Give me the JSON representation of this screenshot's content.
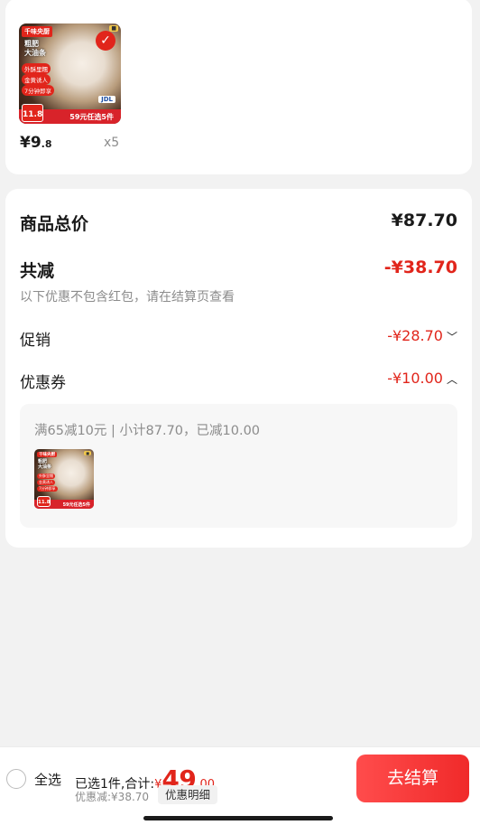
{
  "product": {
    "thumb": {
      "brand": "千味央厨",
      "title_line1": "粗肥",
      "title_line2": "大油条",
      "chips": [
        "外酥里糯",
        "金黄诱人",
        "7分钟即享"
      ],
      "price": "11.8",
      "promo": "59元任选5件",
      "logistics": "JDL"
    },
    "unit_price_main": "¥9",
    "unit_price_decimal": ".8",
    "quantity": "x5",
    "selected": true
  },
  "summary": {
    "goods_total_label": "商品总价",
    "goods_total_value": "¥87.70",
    "total_reduction_label": "共减",
    "total_reduction_value": "-¥38.70",
    "note": "以下优惠不包含红包，请在结算页查看",
    "promotion_label": "促销",
    "promotion_value": "-¥28.70",
    "coupon_label": "优惠券",
    "coupon_value": "-¥10.00",
    "coupon_detail": "满65减10元 | 小计87.70，已减10.00"
  },
  "bottom_bar": {
    "select_all_label": "全选",
    "selected_text": "已选1件,合计:",
    "currency": "¥",
    "total_integer": "49",
    "total_decimal": ".00",
    "discount_text": "优惠减:¥38.70",
    "detail_button": "优惠明细",
    "checkout_button": "去结算"
  },
  "colors": {
    "accent": "#e1251b",
    "background": "#f2f2f2"
  }
}
